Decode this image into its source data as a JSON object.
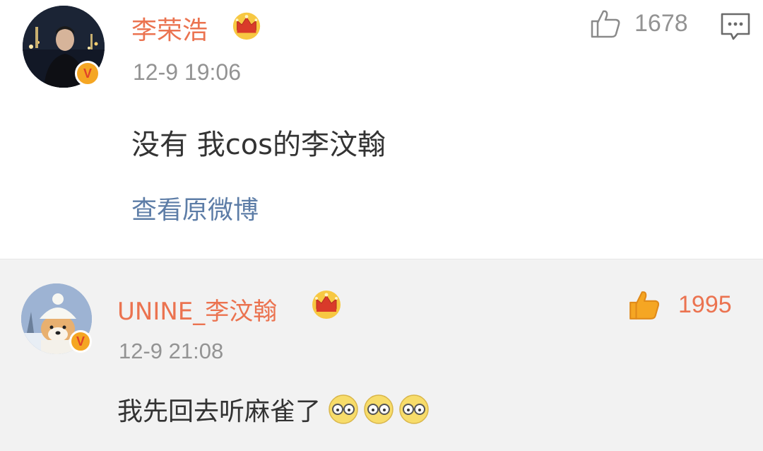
{
  "comments": [
    {
      "username": "李荣浩",
      "verified_badge": "V",
      "time": "12-9 19:06",
      "text": "没有 我cos的李汶翰",
      "link": "查看原微博",
      "likes": "1678",
      "liked": false,
      "avatar_icon": "person-night-city-avatar",
      "crown_icon": "crown-icon"
    },
    {
      "username": "UNINE_李汶翰",
      "verified_badge": "V",
      "time": "12-9 21:08",
      "text": "我先回去听麻雀了",
      "emojis": [
        "glasses-face-emoji",
        "glasses-face-emoji",
        "glasses-face-emoji"
      ],
      "likes": "1995",
      "liked": true,
      "avatar_icon": "shiba-dog-avatar",
      "crown_icon": "crown-icon"
    }
  ],
  "colors": {
    "username": "#eb7350",
    "time": "#939393",
    "link": "#5d7da7",
    "liked": "#f5a623",
    "badge": "#f5a623",
    "reply_bg": "#f2f2f2"
  }
}
